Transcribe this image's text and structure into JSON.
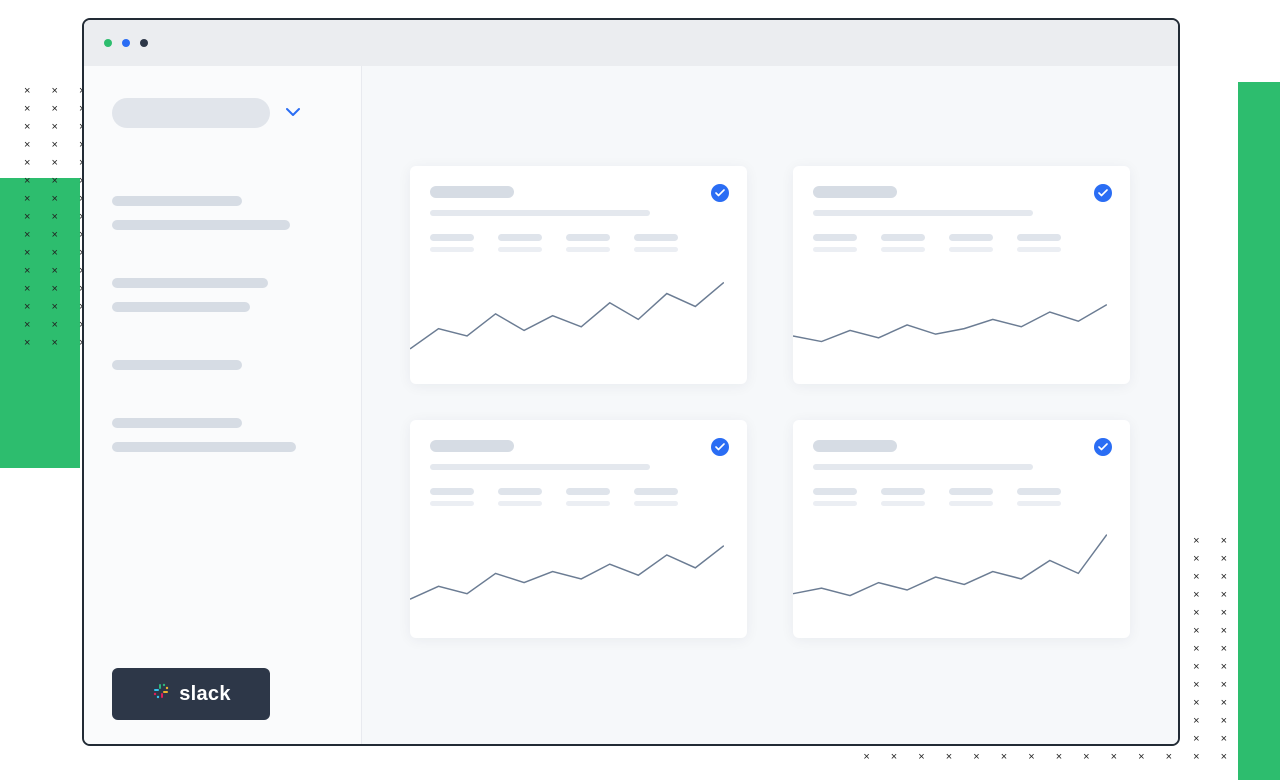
{
  "sidebar": {
    "integration_label": "slack"
  },
  "cards": [
    {
      "chart_data": {
        "type": "line",
        "values": [
          38,
          60,
          52,
          76,
          58,
          74,
          62,
          88,
          70,
          98,
          84,
          110
        ],
        "range": [
          0,
          130
        ]
      }
    },
    {
      "chart_data": {
        "type": "line",
        "values": [
          52,
          46,
          58,
          50,
          64,
          54,
          60,
          70,
          62,
          78,
          68,
          86
        ],
        "range": [
          0,
          130
        ]
      }
    },
    {
      "chart_data": {
        "type": "line",
        "values": [
          42,
          56,
          48,
          70,
          60,
          72,
          64,
          80,
          68,
          90,
          76,
          100
        ],
        "range": [
          0,
          130
        ]
      }
    },
    {
      "chart_data": {
        "type": "line",
        "values": [
          48,
          54,
          46,
          60,
          52,
          66,
          58,
          72,
          64,
          84,
          70,
          112
        ],
        "range": [
          0,
          130
        ]
      }
    }
  ]
}
